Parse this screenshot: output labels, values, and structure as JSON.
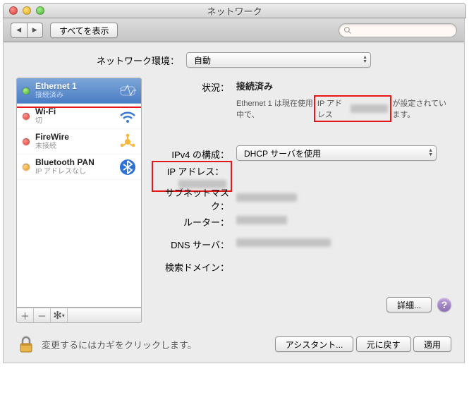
{
  "window": {
    "title": "ネットワーク"
  },
  "toolbar": {
    "show_all": "すべてを表示"
  },
  "location": {
    "label": "ネットワーク環境：",
    "value": "自動"
  },
  "sidebar": {
    "items": [
      {
        "name": "Ethernet 1",
        "sub": "接続済み",
        "status": "green",
        "icon": "ethernet"
      },
      {
        "name": "Wi-Fi",
        "sub": "切",
        "status": "red",
        "icon": "wifi"
      },
      {
        "name": "FireWire",
        "sub": "未接続",
        "status": "red",
        "icon": "firewire"
      },
      {
        "name": "Bluetooth PAN",
        "sub": "IP アドレスなし",
        "status": "orange",
        "icon": "bluetooth"
      }
    ]
  },
  "status": {
    "label": "状況：",
    "value": "接続済み",
    "desc_pre": "Ethernet 1 は現在使用中で、",
    "desc_iplabel": "IP アドレス",
    "desc_post": "が設定されています。"
  },
  "ipv4": {
    "label": "IPv4 の構成：",
    "value": "DHCP サーバを使用"
  },
  "rows": {
    "ip": {
      "label": "IP アドレス："
    },
    "subnet": {
      "label": "サブネットマスク："
    },
    "router": {
      "label": "ルーター："
    },
    "dns": {
      "label": "DNS サーバ："
    },
    "search": {
      "label": "検索ドメイン："
    }
  },
  "advanced": {
    "label": "詳細..."
  },
  "footer": {
    "lock_msg": "変更するにはカギをクリックします。",
    "assistant": "アシスタント...",
    "revert": "元に戻す",
    "apply": "適用"
  }
}
